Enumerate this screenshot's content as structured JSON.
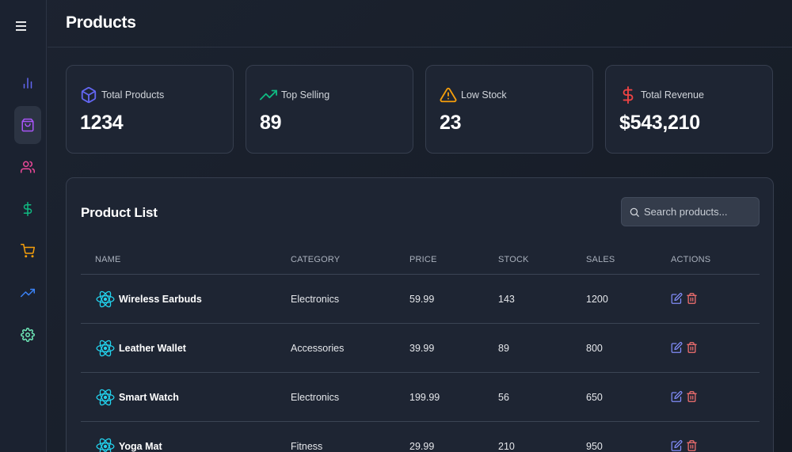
{
  "header": {
    "title": "Products"
  },
  "sidebar": {
    "items": [
      {
        "icon": "bar-chart-icon",
        "color": "#6366f1"
      },
      {
        "icon": "shopping-bag-icon",
        "color": "#a855f7",
        "active": true
      },
      {
        "icon": "users-icon",
        "color": "#ec4899"
      },
      {
        "icon": "dollar-sign-icon",
        "color": "#10b981"
      },
      {
        "icon": "shopping-cart-icon",
        "color": "#f59e0b"
      },
      {
        "icon": "trending-up-icon",
        "color": "#3b82f6"
      },
      {
        "icon": "settings-icon",
        "color": "#6ee7b7"
      }
    ]
  },
  "stats": [
    {
      "label": "Total Products",
      "value": "1234",
      "icon": "package-icon",
      "color": "#6366f1"
    },
    {
      "label": "Top Selling",
      "value": "89",
      "icon": "trending-up-icon",
      "color": "#10b981"
    },
    {
      "label": "Low Stock",
      "value": "23",
      "icon": "alert-triangle-icon",
      "color": "#f59e0b"
    },
    {
      "label": "Total Revenue",
      "value": "$543,210",
      "icon": "dollar-sign-icon",
      "color": "#ef4444"
    }
  ],
  "product_list": {
    "title": "Product List",
    "search": {
      "placeholder": "Search products...",
      "value": ""
    },
    "columns": [
      "NAME",
      "CATEGORY",
      "PRICE",
      "STOCK",
      "SALES",
      "ACTIONS"
    ],
    "rows": [
      {
        "name": "Wireless Earbuds",
        "category": "Electronics",
        "price": "59.99",
        "stock": "143",
        "sales": "1200"
      },
      {
        "name": "Leather Wallet",
        "category": "Accessories",
        "price": "39.99",
        "stock": "89",
        "sales": "800"
      },
      {
        "name": "Smart Watch",
        "category": "Electronics",
        "price": "199.99",
        "stock": "56",
        "sales": "650"
      },
      {
        "name": "Yoga Mat",
        "category": "Fitness",
        "price": "29.99",
        "stock": "210",
        "sales": "950"
      }
    ],
    "colors": {
      "react_icon": "#22d3ee",
      "edit": "#818cf8",
      "delete": "#f87171"
    }
  }
}
